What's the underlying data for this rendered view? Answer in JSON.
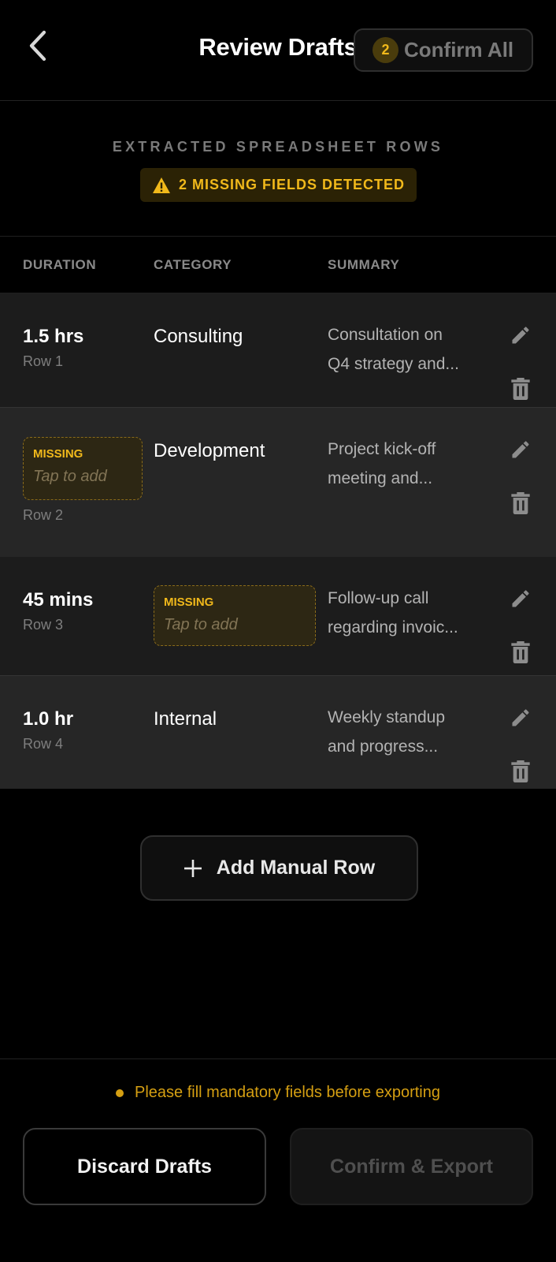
{
  "header": {
    "title": "Review Drafts",
    "back_icon": "chevron-left-icon",
    "confirm_all": {
      "count": "2",
      "label": "Confirm All"
    }
  },
  "subheader": {
    "section_label": "EXTRACTED SPREADSHEET ROWS",
    "warning": {
      "icon": "warning-triangle-icon",
      "text": "2 MISSING FIELDS DETECTED"
    }
  },
  "table": {
    "columns": [
      "DURATION",
      "CATEGORY",
      "SUMMARY"
    ],
    "rows": [
      {
        "duration": "1.5 hrs",
        "row_label": "Row 1",
        "category": "Consulting",
        "summary_lines": [
          "Consultation on",
          "Q4 strategy and..."
        ]
      },
      {
        "duration_missing": {
          "tag": "MISSING",
          "hint": "Tap to add"
        },
        "row_label": "Row 2",
        "category": "Development",
        "summary_lines": [
          "Project kick-off",
          "meeting and..."
        ]
      },
      {
        "duration": "45 mins",
        "row_label": "Row 3",
        "category_missing": {
          "tag": "MISSING",
          "hint": "Tap to add"
        },
        "summary_lines": [
          "Follow-up call",
          "regarding invoic..."
        ]
      },
      {
        "duration": "1.0 hr",
        "row_label": "Row 4",
        "category": "Internal",
        "summary_lines": [
          "Weekly standup",
          "and progress..."
        ]
      }
    ],
    "row_actions": {
      "edit_icon": "pencil-icon",
      "delete_icon": "trash-icon"
    }
  },
  "add_row": {
    "icon": "plus-icon",
    "label": "Add Manual Row"
  },
  "footer": {
    "note": "Please fill mandatory fields before exporting",
    "discard_label": "Discard Drafts",
    "export_label": "Confirm & Export"
  },
  "colors": {
    "background": "#000000",
    "accent": "#f1b91b",
    "warning_text": "#d59f12",
    "row_odd": "#1c1c1c",
    "row_even": "#262626"
  }
}
